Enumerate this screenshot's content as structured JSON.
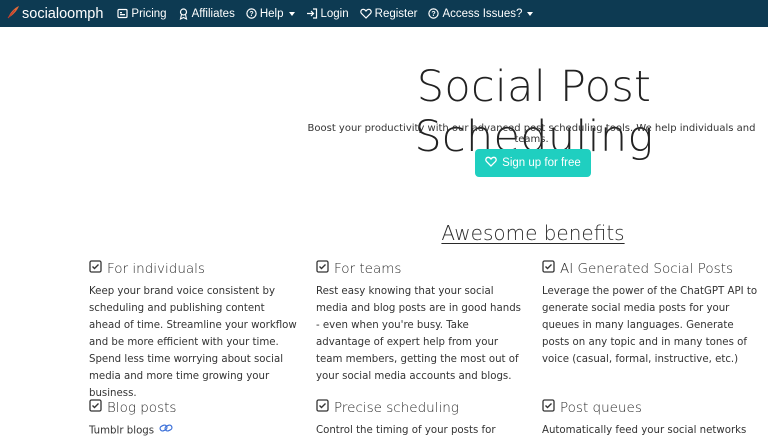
{
  "nav": {
    "brand": "socialoomph",
    "items": [
      {
        "label": "Pricing",
        "icon": "pricing-icon",
        "dropdown": false
      },
      {
        "label": "Affiliates",
        "icon": "affiliates-icon",
        "dropdown": false
      },
      {
        "label": "Help",
        "icon": "help-icon",
        "dropdown": true
      },
      {
        "label": "Login",
        "icon": "login-icon",
        "dropdown": false
      },
      {
        "label": "Register",
        "icon": "heart-icon",
        "dropdown": false
      },
      {
        "label": "Access Issues?",
        "icon": "help-icon",
        "dropdown": true
      }
    ]
  },
  "hero": {
    "title": "Social Post Scheduling",
    "subtitle": "Boost your productivity with our advanced post scheduling tools. We help individuals and teams.",
    "cta": "Sign up for free"
  },
  "benefits": {
    "title": "Awesome benefits",
    "items": [
      {
        "title": "For individuals",
        "desc": "Keep your brand voice consistent by scheduling and publishing content ahead of time. Streamline your workflow and be more efficient with your time. Spend less time worrying about social media and more time growing your business."
      },
      {
        "title": "For teams",
        "desc": "Rest easy knowing that your social media and blog posts are in good hands - even when you're busy. Take advantage of expert help from your team members, getting the most out of your social media accounts and blogs."
      },
      {
        "title": "AI Generated Social Posts",
        "desc": "Leverage the power of the ChatGPT API to generate social media posts for your queues in many languages. Generate posts on any topic and in many tones of voice (casual, formal, instructive, etc.)"
      },
      {
        "title": "Blog posts",
        "desc": "Tumblr blogs"
      },
      {
        "title": "Precise scheduling",
        "desc": "Control the timing of your posts for"
      },
      {
        "title": "Post queues",
        "desc": "Automatically feed your social networks"
      }
    ]
  },
  "colors": {
    "navbar": "#0d3a52",
    "cta": "#1fcfc0"
  }
}
